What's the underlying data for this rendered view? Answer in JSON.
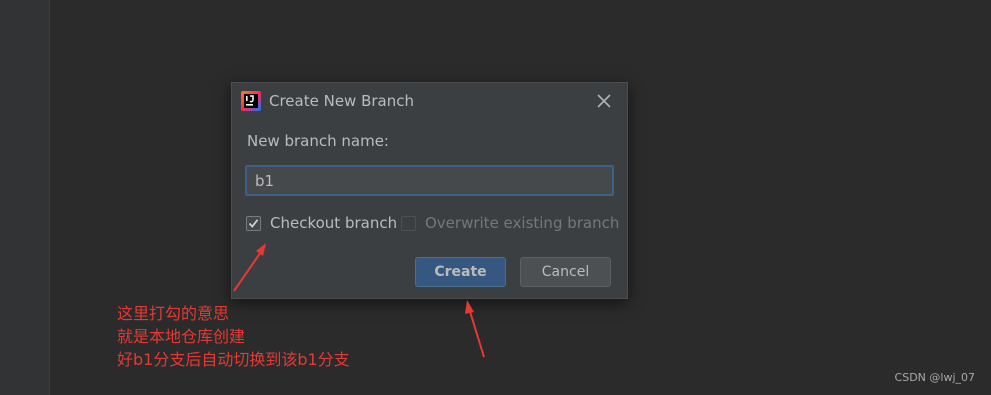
{
  "dialog": {
    "title": "Create New Branch",
    "field_label": "New branch name:",
    "branch_name_value": "b1",
    "checkout": {
      "label": "Checkout branch",
      "checked": true
    },
    "overwrite": {
      "label": "Overwrite existing branch",
      "checked": false,
      "enabled": false
    },
    "create_label": "Create",
    "cancel_label": "Cancel"
  },
  "annotation": {
    "lines": [
      "这里打勾的意思",
      "就是本地仓库创建",
      "好b1分支后自动切换到该b1分支"
    ],
    "color": "#e53935"
  },
  "watermark": "CSDN @lwj_07",
  "colors": {
    "editor_bg": "#2b2b2b",
    "dialog_bg": "#3c3f41",
    "primary_button": "#365880",
    "text": "#bbbbbb"
  }
}
